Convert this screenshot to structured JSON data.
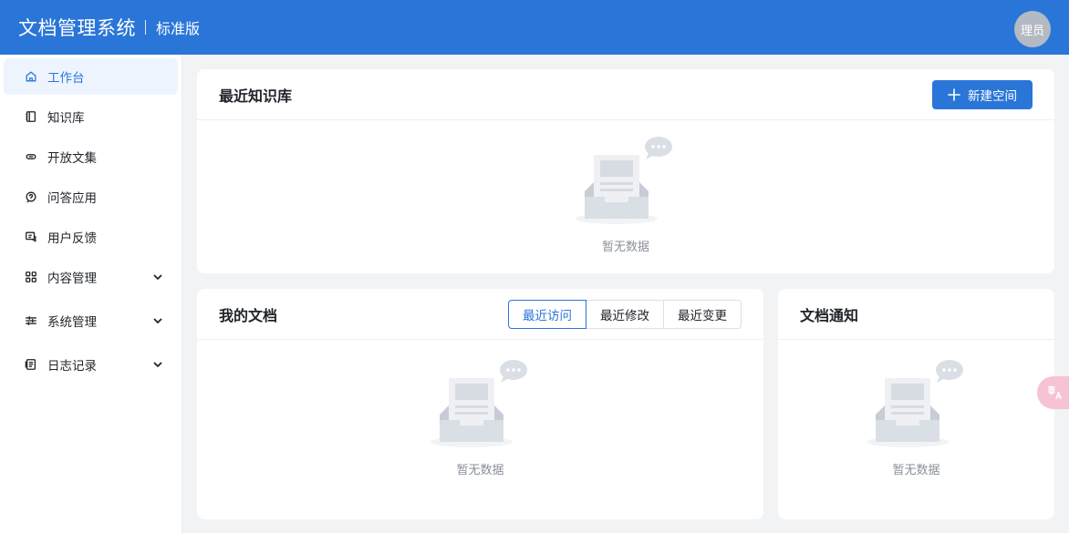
{
  "header": {
    "title": "文档管理系统",
    "edition": "标准版",
    "avatar_text": "理员"
  },
  "sidebar": {
    "items": [
      {
        "label": "工作台",
        "icon": "home-icon",
        "active": true
      },
      {
        "label": "知识库",
        "icon": "book-icon"
      },
      {
        "label": "开放文集",
        "icon": "link-icon"
      },
      {
        "label": "问答应用",
        "icon": "qa-icon"
      },
      {
        "label": "用户反馈",
        "icon": "feedback-icon"
      },
      {
        "label": "内容管理",
        "icon": "grid-icon",
        "expandable": true
      },
      {
        "label": "系统管理",
        "icon": "sliders-icon",
        "expandable": true
      },
      {
        "label": "日志记录",
        "icon": "log-icon",
        "expandable": true
      }
    ]
  },
  "recent_kb": {
    "title": "最近知识库",
    "new_button": "新建空间",
    "empty_text": "暂无数据"
  },
  "my_docs": {
    "title": "我的文档",
    "tabs": [
      "最近访问",
      "最近修改",
      "最近变更"
    ],
    "active_tab": "最近访问",
    "empty_text": "暂无数据"
  },
  "notices": {
    "title": "文档通知",
    "empty_text": "暂无数据"
  },
  "colors": {
    "primary": "#2a76d8",
    "float_button": "#f7c2d4"
  }
}
